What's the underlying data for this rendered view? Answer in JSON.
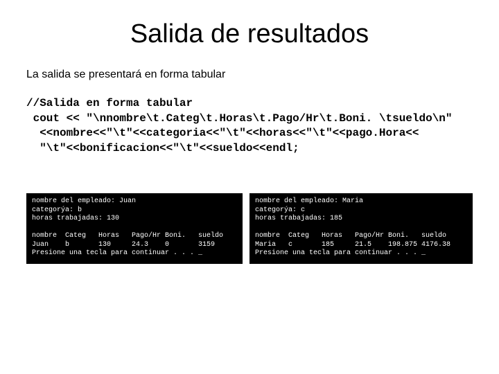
{
  "title": "Salida de resultados",
  "subtitle": "La salida se presentará en forma tabular",
  "code": {
    "l1": "//Salida en forma tabular",
    "l2": " cout << \"\\nnombre\\t.Categ\\t.Horas\\t.Pago/Hr\\t.Boni. \\tsueldo\\n\"",
    "l3": "  <<nombre<<\"\\t\"<<categoria<<\"\\t\"<<horas<<\"\\t\"<<pago.Hora<<",
    "l4": "  \"\\t\"<<bonificacion<<\"\\t\"<<sueldo<<endl;"
  },
  "consoleLeft": {
    "l1": "nombre del empleado: Juan",
    "l2": "categorýa: b",
    "l3": "horas trabajadas: 130",
    "l4": "",
    "l5": "nombre  Categ   Horas   Pago/Hr Boni.   sueldo",
    "l6": "Juan    b       130     24.3    0       3159",
    "l7": "Presione una tecla para continuar . . . _"
  },
  "consoleRight": {
    "l1": "nombre del empleado: Maria",
    "l2": "categorýa: c",
    "l3": "horas trabajadas: 185",
    "l4": "",
    "l5": "nombre  Categ   Horas   Pago/Hr Boni.   sueldo",
    "l6": "Maria   c       185     21.5    198.875 4176.38",
    "l7": "Presione una tecla para continuar . . . _"
  }
}
